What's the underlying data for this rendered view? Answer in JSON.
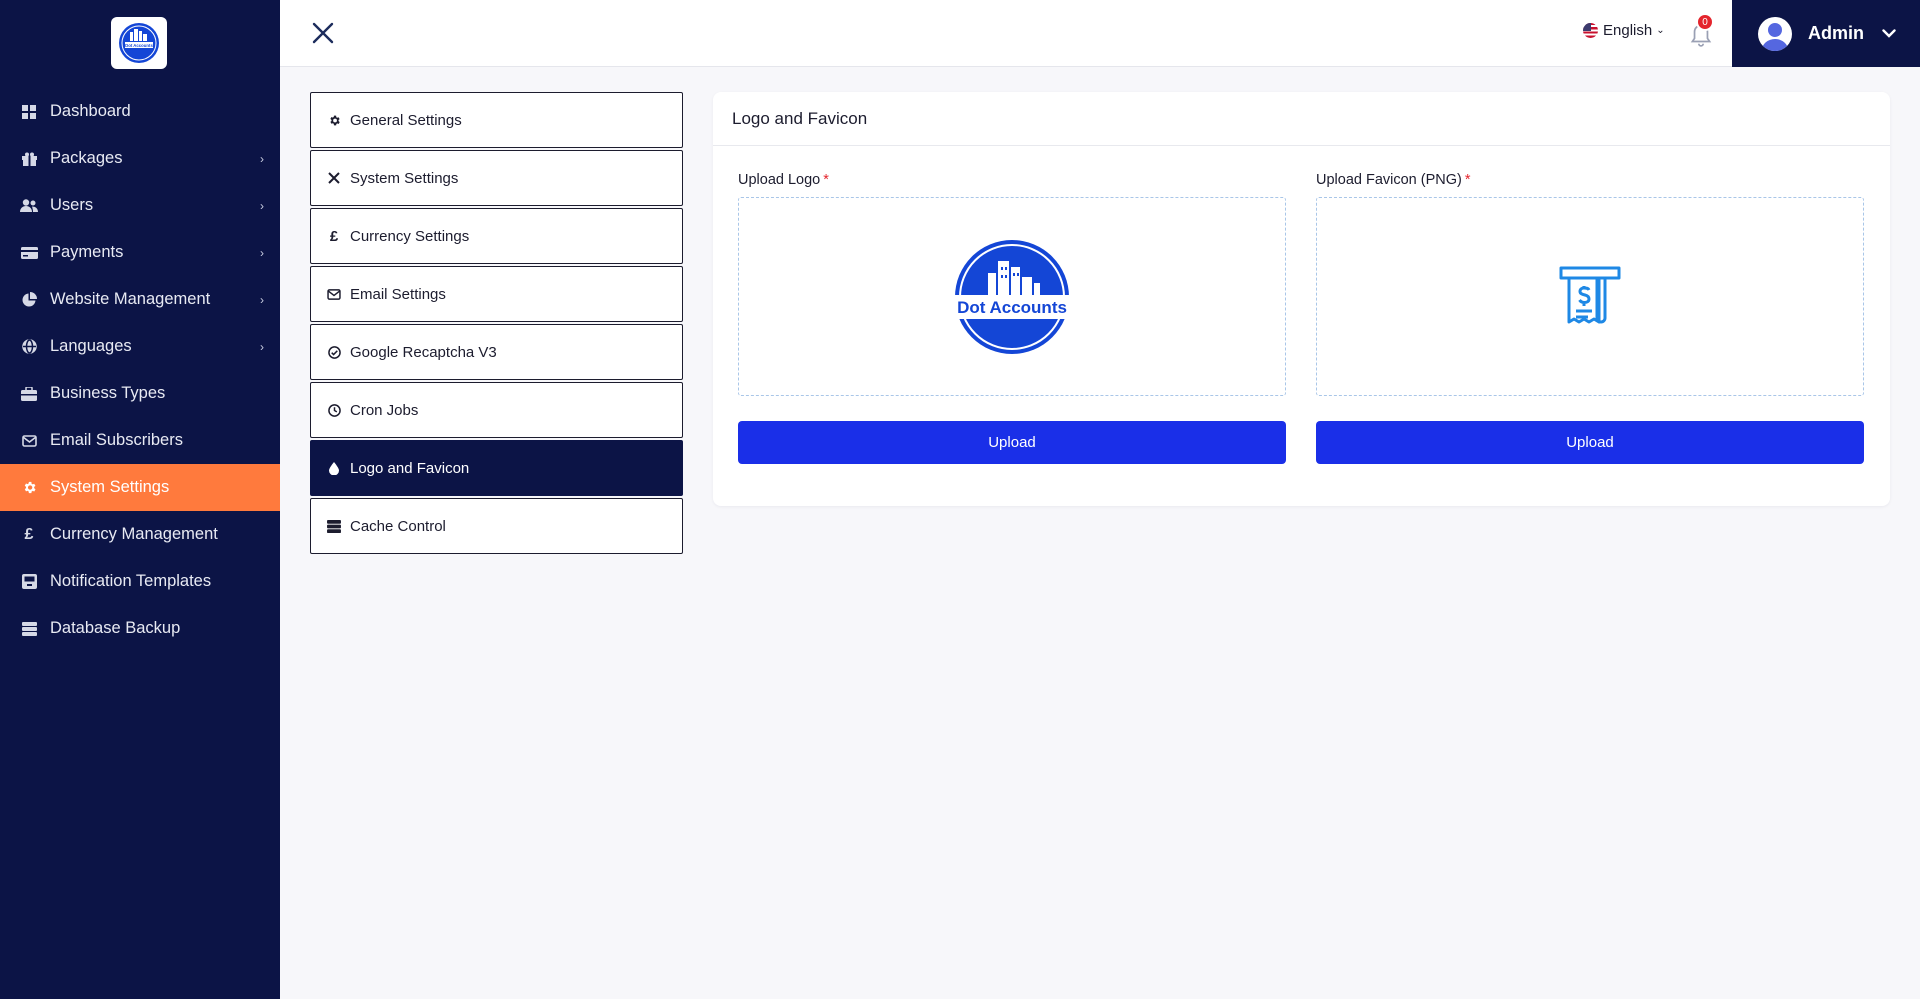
{
  "sidebar": {
    "logo_text": "Dot Accounts",
    "items": [
      {
        "label": "Dashboard",
        "icon": "grid-icon",
        "chevron": false,
        "active": false
      },
      {
        "label": "Packages",
        "icon": "gift-icon",
        "chevron": true,
        "active": false
      },
      {
        "label": "Users",
        "icon": "users-icon",
        "chevron": true,
        "active": false
      },
      {
        "label": "Payments",
        "icon": "credit-card-icon",
        "chevron": true,
        "active": false
      },
      {
        "label": "Website Management",
        "icon": "pie-chart-icon",
        "chevron": true,
        "active": false
      },
      {
        "label": "Languages",
        "icon": "globe-icon",
        "chevron": true,
        "active": false
      },
      {
        "label": "Business Types",
        "icon": "briefcase-icon",
        "chevron": false,
        "active": false
      },
      {
        "label": "Email Subscribers",
        "icon": "envelope-icon",
        "chevron": false,
        "active": false
      },
      {
        "label": "System Settings",
        "icon": "gear-icon",
        "chevron": false,
        "active": true
      },
      {
        "label": "Currency Management",
        "icon": "pound-icon",
        "chevron": false,
        "active": false
      },
      {
        "label": "Notification Templates",
        "icon": "inbox-icon",
        "chevron": false,
        "active": false
      },
      {
        "label": "Database Backup",
        "icon": "server-icon",
        "chevron": false,
        "active": false
      }
    ]
  },
  "header": {
    "language": "English",
    "notification_count": "0",
    "user_name": "Admin"
  },
  "settings_menu": [
    {
      "label": "General Settings",
      "icon": "gear-icon",
      "active": false
    },
    {
      "label": "System Settings",
      "icon": "tools-icon",
      "active": false
    },
    {
      "label": "Currency Settings",
      "icon": "pound-icon",
      "active": false
    },
    {
      "label": "Email Settings",
      "icon": "envelope-icon",
      "active": false
    },
    {
      "label": "Google Recaptcha V3",
      "icon": "check-circle-icon",
      "active": false
    },
    {
      "label": "Cron Jobs",
      "icon": "clock-icon",
      "active": false
    },
    {
      "label": "Logo and Favicon",
      "icon": "droplet-icon",
      "active": true
    },
    {
      "label": "Cache Control",
      "icon": "database-icon",
      "active": false
    }
  ],
  "card": {
    "title": "Logo and Favicon",
    "logo_label": "Upload Logo",
    "favicon_label": "Upload Favicon (PNG)",
    "required_mark": "*",
    "upload_logo_button": "Upload",
    "upload_favicon_button": "Upload",
    "logo_preview_text": "Dot Accounts"
  },
  "colors": {
    "sidebar_bg": "#0c1446",
    "active_accent": "#ff7a3d",
    "primary_button": "#1a2fe8",
    "logo_blue": "#1446d6",
    "favicon_blue": "#1e88e5",
    "badge_red": "#e4252d"
  }
}
